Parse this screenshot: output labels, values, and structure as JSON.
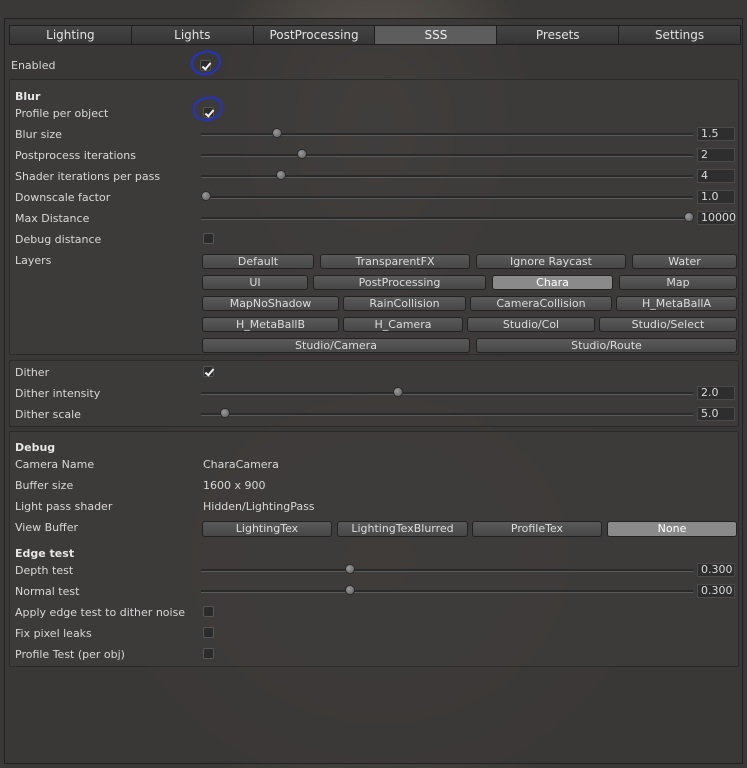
{
  "tabs": [
    "Lighting",
    "Lights",
    "PostProcessing",
    "SSS",
    "Presets",
    "Settings"
  ],
  "active_tab": "SSS",
  "enabled": {
    "label": "Enabled",
    "checked": true
  },
  "blur": {
    "header": "Blur",
    "profile_per_object": {
      "label": "Profile per object",
      "checked": true
    },
    "sliders": [
      {
        "label": "Blur size",
        "value": "1.5",
        "fraction": 0.21
      },
      {
        "label": "Postprocess iterations",
        "value": "2",
        "fraction": 0.2
      },
      {
        "label": "Shader iterations per pass",
        "value": "4",
        "fraction": 0.16
      },
      {
        "label": "Downscale factor",
        "value": "1.0",
        "fraction": 0.0
      },
      {
        "label": "Max Distance",
        "value": "10000",
        "fraction": 1.0
      }
    ],
    "debug_distance": {
      "label": "Debug distance",
      "checked": false
    },
    "layers_label": "Layers",
    "layers": [
      "Default",
      "TransparentFX",
      "Ignore Raycast",
      "Water",
      "UI",
      "PostProcessing",
      "Chara",
      "Map",
      "MapNoShadow",
      "RainCollision",
      "CameraCollision",
      "H_MetaBallA",
      "H_MetaBallB",
      "H_Camera",
      "Studio/Col",
      "Studio/Select",
      "Studio/Camera",
      "Studio/Route"
    ],
    "selected_layer": "Chara"
  },
  "dither": {
    "label": "Dither",
    "checked": true,
    "sliders": [
      {
        "label": "Dither intensity",
        "value": "2.0",
        "fraction": 0.4
      },
      {
        "label": "Dither scale",
        "value": "5.0",
        "fraction": 0.04
      }
    ]
  },
  "debug": {
    "header": "Debug",
    "camera_name": {
      "label": "Camera Name",
      "value": "CharaCamera"
    },
    "buffer_size": {
      "label": "Buffer size",
      "value": "1600 x 900"
    },
    "light_pass_shader": {
      "label": "Light pass shader",
      "value": "Hidden/LightingPass"
    },
    "view_buffer": {
      "label": "View Buffer",
      "options": [
        "LightingTex",
        "LightingTexBlurred",
        "ProfileTex",
        "None"
      ],
      "selected": "None"
    },
    "edge_test_header": "Edge test",
    "sliders": [
      {
        "label": "Depth test",
        "value": "0.300",
        "fraction": 0.3
      },
      {
        "label": "Normal test",
        "value": "0.300",
        "fraction": 0.3
      }
    ],
    "checks": [
      {
        "label": "Apply edge test to dither noise",
        "checked": false
      },
      {
        "label": "Fix pixel leaks",
        "checked": false
      },
      {
        "label": "Profile Test (per obj)",
        "checked": false
      }
    ]
  },
  "colors": {
    "annotation": "#2233cc",
    "selected_button": "#8a8a8a"
  }
}
